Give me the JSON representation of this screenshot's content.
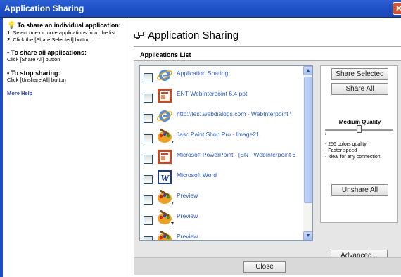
{
  "window": {
    "title": "Application Sharing"
  },
  "sidebar": {
    "individual": {
      "heading": "To share an individual application:",
      "step1_num": "1.",
      "step1": "Select one or more applications from the list",
      "step2_num": "2.",
      "step2": "Click the [Share Selected] button."
    },
    "all": {
      "heading": "To share all applications:",
      "text": "Click [Share All] button."
    },
    "stop": {
      "heading": "To stop sharing:",
      "text": "Click [Unshare All] button"
    },
    "more_help": "More Help"
  },
  "main": {
    "title": "Application Sharing",
    "list_title": "Applications List",
    "items": [
      {
        "label": "Application Sharing",
        "icon": "ie-icon"
      },
      {
        "label": "ENT WebInterpoint 6.4.ppt",
        "icon": "powerpoint-icon"
      },
      {
        "label": "http://test.webdialogs.com - WebInterpoint \\",
        "icon": "ie-icon"
      },
      {
        "label": "Jasc Paint Shop Pro - Image21",
        "icon": "paint-icon",
        "badge": "7"
      },
      {
        "label": "Microsoft PowerPoint - [ENT WebInterpoint 6",
        "icon": "powerpoint-icon"
      },
      {
        "label": "Microsoft Word",
        "icon": "word-icon"
      },
      {
        "label": "Preview",
        "icon": "paint-icon",
        "badge": "7"
      },
      {
        "label": "Preview",
        "icon": "paint-icon",
        "badge": "7"
      },
      {
        "label": "Preview",
        "icon": "paint-icon"
      }
    ],
    "share_selected": "Share Selected",
    "share_all": "Share All",
    "quality": {
      "label": "Medium Quality",
      "level": 0.5,
      "desc": [
        "- 256 colors quality",
        "- Faster speed",
        "- Ideal for any connection"
      ]
    },
    "unshare_all": "Unshare All",
    "advanced": "Advanced...",
    "close": "Close"
  }
}
